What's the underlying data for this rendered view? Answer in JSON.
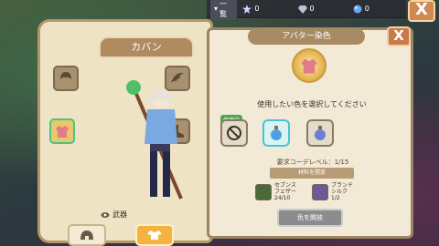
{
  "topbar": {
    "list_label": "一覧",
    "resources": [
      {
        "icon": "star-icon",
        "value": "0"
      },
      {
        "icon": "gem-icon",
        "value": "0"
      },
      {
        "icon": "orb-icon",
        "value": "0"
      }
    ],
    "close_label": "X"
  },
  "bag": {
    "tab_label": "カバン",
    "weapon_label": "武器",
    "slots": [
      "head-slot",
      "cape-slot",
      "top-slot",
      "shoes-slot"
    ],
    "buttons": [
      "helmet-toggle",
      "outfit-toggle"
    ]
  },
  "dye": {
    "title": "アバター染色",
    "close_label": "X",
    "instruction": "使用したい色を選択してください",
    "in_use_badge": "使用中",
    "options": [
      "no-color",
      "blue-potion",
      "purple-potion"
    ],
    "required_level": "要求コーデレベル：1/15",
    "materials_label": "材料を開放",
    "materials": [
      {
        "name_line1": "セブンス",
        "name_line2": "フェザー",
        "count": "24/10"
      },
      {
        "name_line1": "ブランド",
        "name_line2": "シルク",
        "count": "1/2"
      }
    ],
    "unlock_button": "色を開放"
  },
  "colors": {
    "accent": "#cf8a54",
    "panel": "#efe3c6",
    "selected": "#49c2d3",
    "in_use": "#4ca84a"
  }
}
